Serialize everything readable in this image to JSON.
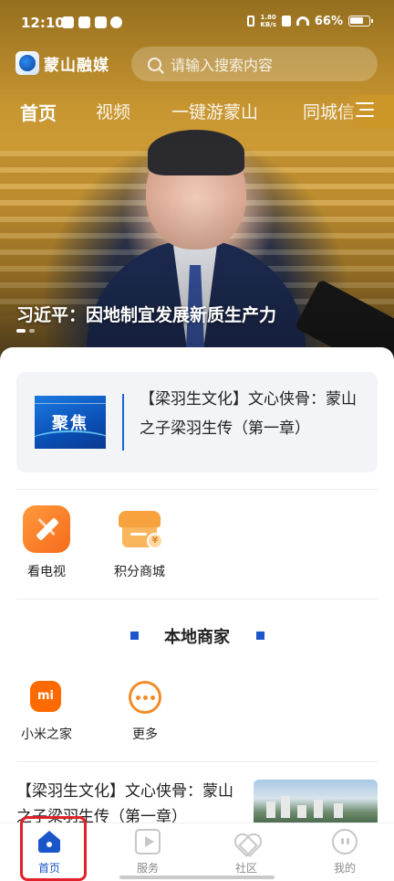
{
  "status_bar": {
    "time": "12:10",
    "speed_top": "1.80",
    "speed_unit": "KB/s",
    "battery": "66%"
  },
  "header": {
    "app_name": "蒙山融媒",
    "search_placeholder": "请输入搜索内容"
  },
  "tabs": [
    {
      "label": "首页",
      "active": true
    },
    {
      "label": "视频"
    },
    {
      "label": "一键游蒙山"
    },
    {
      "label": "同城信"
    }
  ],
  "banner": {
    "caption": "习近平：因地制宜发展新质生产力",
    "slide_index": 1,
    "slide_count": 2
  },
  "featured": {
    "thumb_text": "聚焦",
    "title": "【梁羽生文化】文心侠骨：蒙山之子梁羽生传（第一章）"
  },
  "services": [
    {
      "label": "看电视",
      "icon": "tv-pen-icon"
    },
    {
      "label": "积分商城",
      "icon": "points-shop-icon"
    }
  ],
  "local_merchants": {
    "heading": "本地商家",
    "items": [
      {
        "label": "小米之家",
        "icon": "mi-logo-icon",
        "icon_text": "mi"
      },
      {
        "label": "更多",
        "icon": "more-icon"
      }
    ]
  },
  "news": {
    "title": "【梁羽生文化】文心侠骨：蒙山之子梁羽生传（第一章）"
  },
  "bottom_nav": [
    {
      "label": "首页",
      "icon": "home-icon",
      "active": true
    },
    {
      "label": "服务",
      "icon": "play-icon"
    },
    {
      "label": "社区",
      "icon": "heart-icon"
    },
    {
      "label": "我的",
      "icon": "face-icon"
    }
  ],
  "colors": {
    "accent": "#1a56c9",
    "orange": "#f76b1c",
    "highlight": "#e0202a"
  }
}
